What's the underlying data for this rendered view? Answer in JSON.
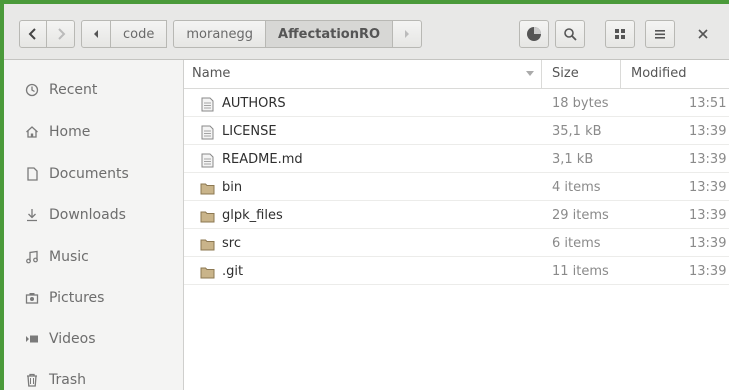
{
  "toolbar": {
    "back_icon": "chevron-left-icon",
    "forward_icon": "chevron-right-icon",
    "breadcrumb_back_icon": "triangle-left-icon",
    "breadcrumbs": [
      "code",
      "moranegg",
      "AffectationRO"
    ],
    "breadcrumb_forward_icon": "triangle-right-icon",
    "buttons": [
      "pie-chart-icon",
      "search-icon",
      "grid-view-icon",
      "menu-icon",
      "close-icon"
    ]
  },
  "sidebar": {
    "items": [
      {
        "label": "Recent",
        "icon": "clock-icon"
      },
      {
        "label": "Home",
        "icon": "home-icon"
      },
      {
        "label": "Documents",
        "icon": "document-icon"
      },
      {
        "label": "Downloads",
        "icon": "download-icon"
      },
      {
        "label": "Music",
        "icon": "music-icon"
      },
      {
        "label": "Pictures",
        "icon": "camera-icon"
      },
      {
        "label": "Videos",
        "icon": "video-icon"
      },
      {
        "label": "Trash",
        "icon": "trash-icon"
      }
    ]
  },
  "columns": {
    "name": "Name",
    "size": "Size",
    "modified": "Modified"
  },
  "files": [
    {
      "name": "AUTHORS",
      "size": "18 bytes",
      "modified": "13:51",
      "type": "file"
    },
    {
      "name": "LICENSE",
      "size": "35,1 kB",
      "modified": "13:39",
      "type": "file"
    },
    {
      "name": "README.md",
      "size": "3,1 kB",
      "modified": "13:39",
      "type": "file"
    },
    {
      "name": "bin",
      "size": "4 items",
      "modified": "13:39",
      "type": "folder"
    },
    {
      "name": "glpk_files",
      "size": "29 items",
      "modified": "13:39",
      "type": "folder"
    },
    {
      "name": "src",
      "size": "6 items",
      "modified": "13:39",
      "type": "folder"
    },
    {
      "name": ".git",
      "size": "11 items",
      "modified": "13:39",
      "type": "folder"
    }
  ],
  "colors": {
    "accent_bg": "#4a9a3a",
    "folder": "#c9b48a"
  }
}
